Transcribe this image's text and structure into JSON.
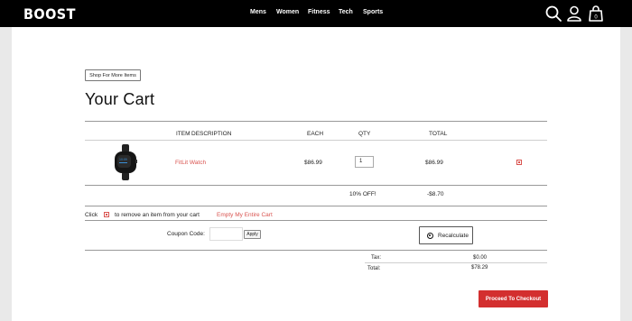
{
  "header": {
    "logo": "BOOST",
    "nav": [
      "Mens",
      "Women",
      "Fitness",
      "Tech",
      "Sports"
    ],
    "icons": [
      "search-icon",
      "account-icon",
      "cart-icon"
    ],
    "cart_count": "0"
  },
  "shop_more_label": "Shop For More Items",
  "page_title": "Your Cart",
  "table": {
    "headers": {
      "item": "ITEM",
      "description": "DESCRIPTION",
      "each": "EACH",
      "qty": "QTY",
      "total": "TOTAL"
    },
    "rows": [
      {
        "name": "FitLit Watch",
        "each": "$86.99",
        "qty": "1",
        "total": "$86.99"
      }
    ],
    "discount_label": "10% OFF!",
    "discount_value": "-$8.70"
  },
  "remove_hint": {
    "prefix": "Click",
    "suffix": "to remove an item from your cart",
    "empty_link": "Empty My Entire Cart"
  },
  "coupon": {
    "label": "Coupon Code:",
    "value": "",
    "apply_label": "Apply"
  },
  "recalculate_label": "Recalculate",
  "summary": {
    "tax_label": "Tax:",
    "tax_value": "$0.00",
    "total_label": "Total:",
    "total_value": "$78.29"
  },
  "checkout_label": "Proceed To Checkout",
  "colors": {
    "accent": "#d32f2f",
    "link_red": "#d9534f",
    "header_bg": "#000000"
  }
}
